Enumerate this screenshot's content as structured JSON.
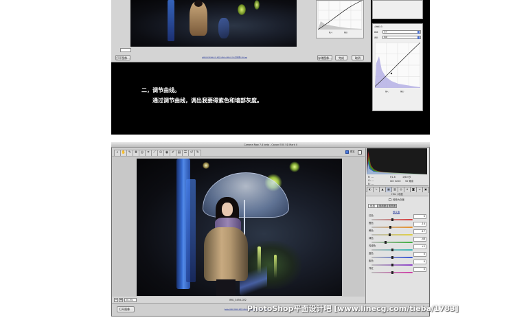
{
  "upper": {
    "left_button": "打开图像...",
    "bottom_link": "sRGB IEC61966-2.1; 8 位; 5184 x 3456 (17.9 百万像素); 300 ppi",
    "buttons": [
      "存储图像...",
      "完成",
      "取消"
    ],
    "curve_panel": {
      "title": "点曲线: 自",
      "row1_label": "曲线:",
      "row1_value": "自定",
      "row2_label": "通道:",
      "row2_value": "RGB",
      "readout_input": "输入:",
      "readout_output": "输出:"
    },
    "caption_title": "二，调节曲线。",
    "caption_body": "通过调节曲线，调出我要得紫色和墙部灰度。"
  },
  "window": {
    "title": "Camera Raw 7.4 beta - Canon EOS 5D Mark II",
    "preview_label": "预览",
    "zoom_value": "20.3%",
    "filename": "IMG_3456.CR2",
    "open_button": "打开图像...",
    "workflow_link": "Adobe RGB (1998); 8 位; 5184 x 3456 (17.9 百万像素); 300 ppi",
    "tools": [
      "缩放",
      "抓手",
      "白平衡",
      "颜色取样",
      "目标调整",
      "裁剪",
      "拉直",
      "污点去除",
      "红眼",
      "调整画笔",
      "渐变滤镜",
      "首选项",
      "逆时针旋转",
      "顺时针旋转"
    ],
    "exif": {
      "r": "R: ---",
      "g": "G: ---",
      "b": "B: ---",
      "aperture": "f/1.8",
      "shutter": "1/60 秒",
      "iso": "ISO 3200",
      "focal": "50 毫米"
    },
    "panel_tabs": [
      "基本",
      "色调曲线",
      "细节",
      "HSL",
      "分离色调",
      "镜头",
      "效果",
      "相机校准",
      "预设",
      "快照"
    ],
    "panel_title": "HSL / 灰度",
    "grayscale_checkbox": "转换为灰度",
    "sub_tabs": [
      "色相",
      "饱和度",
      "明亮度"
    ],
    "default_button": "默认值",
    "sliders": [
      {
        "label": "红色",
        "value": "0",
        "color": "#d83a3a"
      },
      {
        "label": "橙色",
        "value": "-14",
        "color": "#e8922a"
      },
      {
        "label": "黄色",
        "value": "-17",
        "color": "#e0d040"
      },
      {
        "label": "绿色",
        "value": "-48",
        "color": "#3fae3f"
      },
      {
        "label": "浅绿色",
        "value": "+2",
        "color": "#39b8b8"
      },
      {
        "label": "蓝色",
        "value": "0",
        "color": "#3b57d8"
      },
      {
        "label": "紫色",
        "value": "0",
        "color": "#8d40c8"
      },
      {
        "label": "洋红",
        "value": "0",
        "color": "#d040a8"
      }
    ],
    "slider_levels": [
      0.5,
      0.45,
      0.44,
      0.34,
      0.51,
      0.5,
      0.5,
      0.5
    ]
  },
  "watermark": "PhotoShop平面设计吧 [www.linecg.com/tieba/1783]"
}
